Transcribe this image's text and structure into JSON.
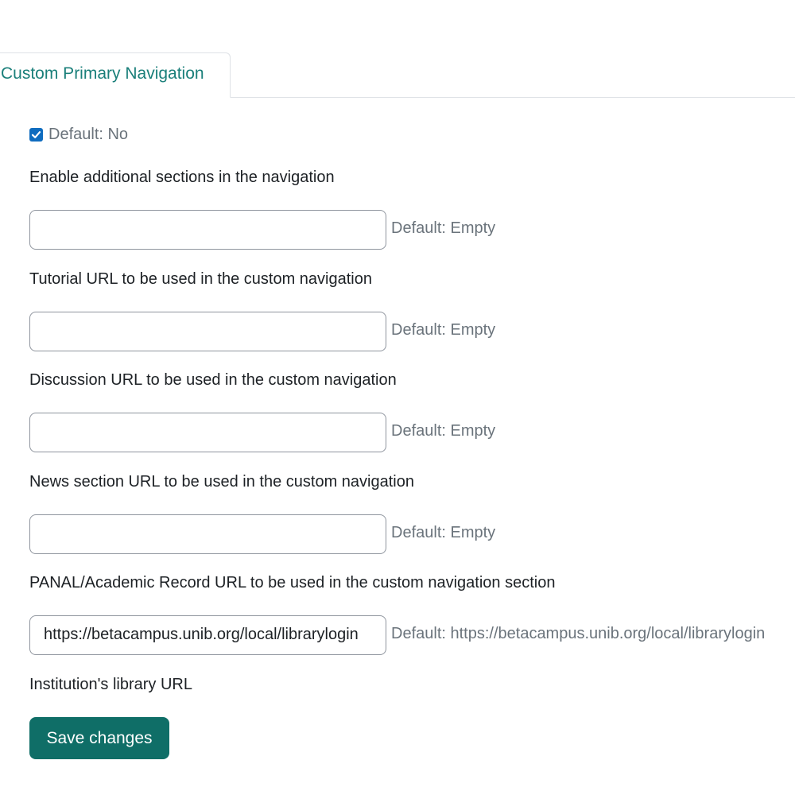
{
  "tabs": [
    {
      "label": "Custom Primary Navigation",
      "active": true
    }
  ],
  "settings": {
    "enable_sections": {
      "checked": true,
      "default_label": "Default: No",
      "description": "Enable additional sections in the navigation"
    },
    "tutorial_url": {
      "value": "",
      "default_label": "Default: Empty",
      "description": "Tutorial URL to be used in the custom navigation"
    },
    "discussion_url": {
      "value": "",
      "default_label": "Default: Empty",
      "description": "Discussion URL to be used in the custom navigation"
    },
    "news_url": {
      "value": "",
      "default_label": "Default: Empty",
      "description": "News section URL to be used in the custom navigation"
    },
    "panal_url": {
      "value": "",
      "default_label": "Default: Empty",
      "description": "PANAL/Academic Record URL to be used in the custom navigation section"
    },
    "library_url": {
      "value": "https://betacampus.unib.org/local/librarylogin",
      "default_label": "Default: https://betacampus.unib.org/local/librarylogin",
      "description": "Institution's library URL"
    }
  },
  "actions": {
    "save_label": "Save changes"
  },
  "colors": {
    "tab_text": "#1a7f7a",
    "checkbox": "#0f6cbf",
    "save_button": "#0f6e67",
    "muted_text": "#6a737b"
  }
}
